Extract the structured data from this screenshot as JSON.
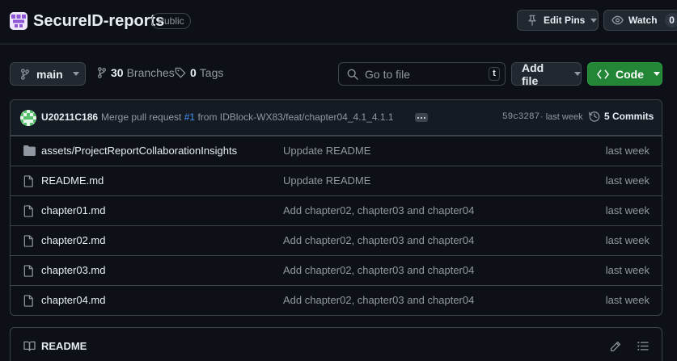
{
  "repo": {
    "name": "SecureID-reports",
    "visibility": "Public",
    "logo_icon": "repo-logo-icon"
  },
  "header_actions": {
    "edit_pins_label": "Edit Pins",
    "watch_label": "Watch",
    "watch_count": "0"
  },
  "toolbar": {
    "branch": "main",
    "branches_count": "30",
    "branches_label": "Branches",
    "tags_count": "0",
    "tags_label": "Tags",
    "search_placeholder": "Go to file",
    "search_shortcut": "t",
    "add_file_label": "Add file",
    "code_label": "Code"
  },
  "latest_commit": {
    "author": "U20211C186",
    "message_prefix": "Merge pull request",
    "pr_link": "#1",
    "message_suffix": "from IDBlock-WX83/feat/chapter04_4.1_4.1.1",
    "sha": "59c3287",
    "separator": "·",
    "time": "last week",
    "commits_label": "5 Commits"
  },
  "files": [
    {
      "type": "folder",
      "icon": "folder-icon",
      "name": "assets/ProjectReportCollaborationInsights",
      "message": "Uppdate README",
      "time": "last week"
    },
    {
      "type": "file",
      "icon": "file-icon",
      "name": "README.md",
      "message": "Uppdate README",
      "time": "last week"
    },
    {
      "type": "file",
      "icon": "file-icon",
      "name": "chapter01.md",
      "message": "Add chapter02, chapter03 and chapter04",
      "time": "last week"
    },
    {
      "type": "file",
      "icon": "file-icon",
      "name": "chapter02.md",
      "message": "Add chapter02, chapter03 and chapter04",
      "time": "last week"
    },
    {
      "type": "file",
      "icon": "file-icon",
      "name": "chapter03.md",
      "message": "Add chapter02, chapter03 and chapter04",
      "time": "last week"
    },
    {
      "type": "file",
      "icon": "file-icon",
      "name": "chapter04.md",
      "message": "Add chapter02, chapter03 and chapter04",
      "time": "last week"
    }
  ],
  "readme": {
    "title": "README"
  },
  "colors": {
    "background": "#0d1117",
    "border": "#3d444d",
    "accent_green": "#238636",
    "link_blue": "#4493f8",
    "muted_text": "#9198a1"
  }
}
